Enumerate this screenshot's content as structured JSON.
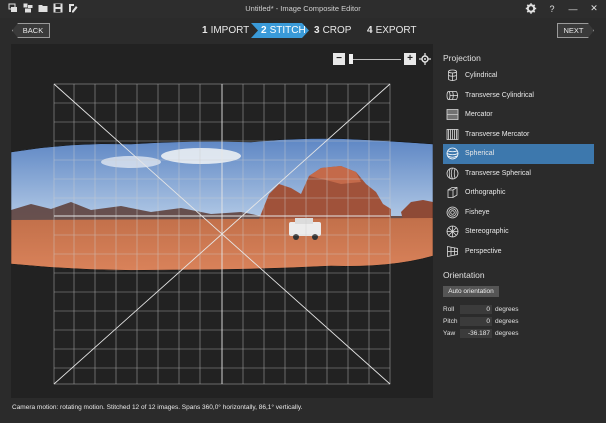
{
  "window": {
    "title": "Untitled* - Image Composite Editor",
    "toolbar_icons": [
      "new-panorama-icon",
      "new-panorama-from-video-icon",
      "open-icon",
      "save-icon",
      "edit-icon"
    ],
    "controls": [
      "settings-icon",
      "help-icon",
      "minimize-icon",
      "close-icon"
    ],
    "help_glyph": "?",
    "minimize_glyph": "—",
    "close_glyph": "✕"
  },
  "nav": {
    "back_label": "BACK",
    "next_label": "NEXT",
    "steps": [
      {
        "num": "1",
        "label": "IMPORT",
        "active": false
      },
      {
        "num": "2",
        "label": "STITCH",
        "active": true
      },
      {
        "num": "3",
        "label": "CROP",
        "active": false
      },
      {
        "num": "4",
        "label": "EXPORT",
        "active": false
      }
    ]
  },
  "zoom": {
    "minus": "−",
    "plus": "+",
    "level": 0.0
  },
  "projection": {
    "title": "Projection",
    "items": [
      {
        "label": "Cylindrical",
        "icon": "cylindrical-icon",
        "selected": false
      },
      {
        "label": "Transverse Cylindrical",
        "icon": "transverse-cylindrical-icon",
        "selected": false
      },
      {
        "label": "Mercator",
        "icon": "mercator-icon",
        "selected": false
      },
      {
        "label": "Transverse Mercator",
        "icon": "transverse-mercator-icon",
        "selected": false
      },
      {
        "label": "Spherical",
        "icon": "spherical-icon",
        "selected": true
      },
      {
        "label": "Transverse Spherical",
        "icon": "transverse-spherical-icon",
        "selected": false
      },
      {
        "label": "Orthographic",
        "icon": "orthographic-icon",
        "selected": false
      },
      {
        "label": "Fisheye",
        "icon": "fisheye-icon",
        "selected": false
      },
      {
        "label": "Stereographic",
        "icon": "stereographic-icon",
        "selected": false
      },
      {
        "label": "Perspective",
        "icon": "perspective-icon",
        "selected": false
      }
    ]
  },
  "orientation": {
    "title": "Orientation",
    "auto_label": "Auto orientation",
    "roll": {
      "label": "Roll",
      "value": "0",
      "unit": "degrees"
    },
    "pitch": {
      "label": "Pitch",
      "value": "0",
      "unit": "degrees"
    },
    "yaw": {
      "label": "Yaw",
      "value": "-36.187",
      "unit": "degrees"
    }
  },
  "status": "Camera motion: rotating motion. Stitched 12 of 12 images. Spans 360,0° horizontally, 86,1° vertically.",
  "colors": {
    "accent": "#3a9ad8",
    "selected_row": "#3d78ad",
    "background": "#2b2b2b"
  }
}
